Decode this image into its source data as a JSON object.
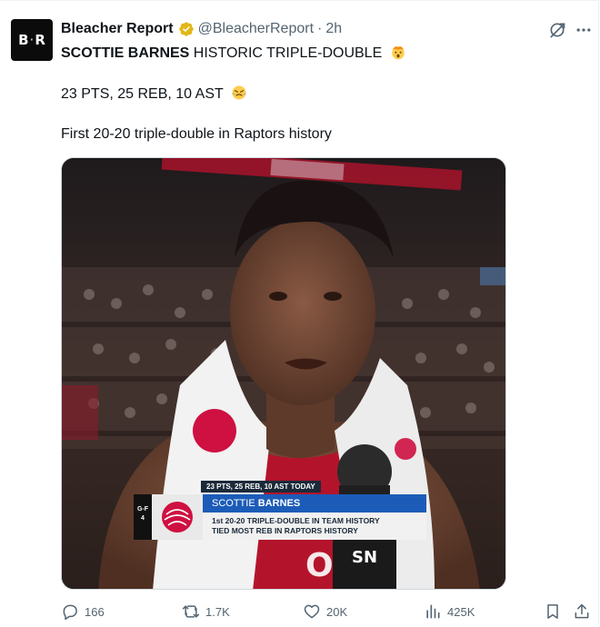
{
  "author": {
    "display_name": "Bleacher Report",
    "handle": "@BleacherReport",
    "separator": "·",
    "time": "2h",
    "avatar_text_left": "B",
    "avatar_text_sep": "·",
    "avatar_text_right": "R",
    "verified": true
  },
  "tweet": {
    "line1_bold": "SCOTTIE BARNES",
    "line1_rest": " HISTORIC TRIPLE-DOUBLE",
    "line1_emoji": "exploding-head-emoji",
    "line2": "23 PTS, 25 REB, 10 AST",
    "line2_emoji": "triumph-face-emoji",
    "line3": "First 20-20 triple-double in Raptors history"
  },
  "media": {
    "broadcast_top": "23 PTS, 25 REB, 10 AST TODAY",
    "position_label_top": "G-F",
    "position_label_bottom": "4",
    "player_first": "SCOTTIE",
    "player_last": "BARNES",
    "info_line1": "1st 20-20 TRIPLE-DOUBLE IN TEAM HISTORY",
    "info_line2": "TIED MOST REB IN RAPTORS HISTORY",
    "mic_logo": "SN"
  },
  "actions": {
    "replies": "166",
    "retweets": "1.7K",
    "likes": "20K",
    "views": "425K"
  },
  "colors": {
    "text_primary": "#0f1419",
    "text_secondary": "#536471",
    "verified_gold": "#e2b719",
    "raptors_red": "#ce1141",
    "broadcast_blue": "#1c5cb8"
  }
}
